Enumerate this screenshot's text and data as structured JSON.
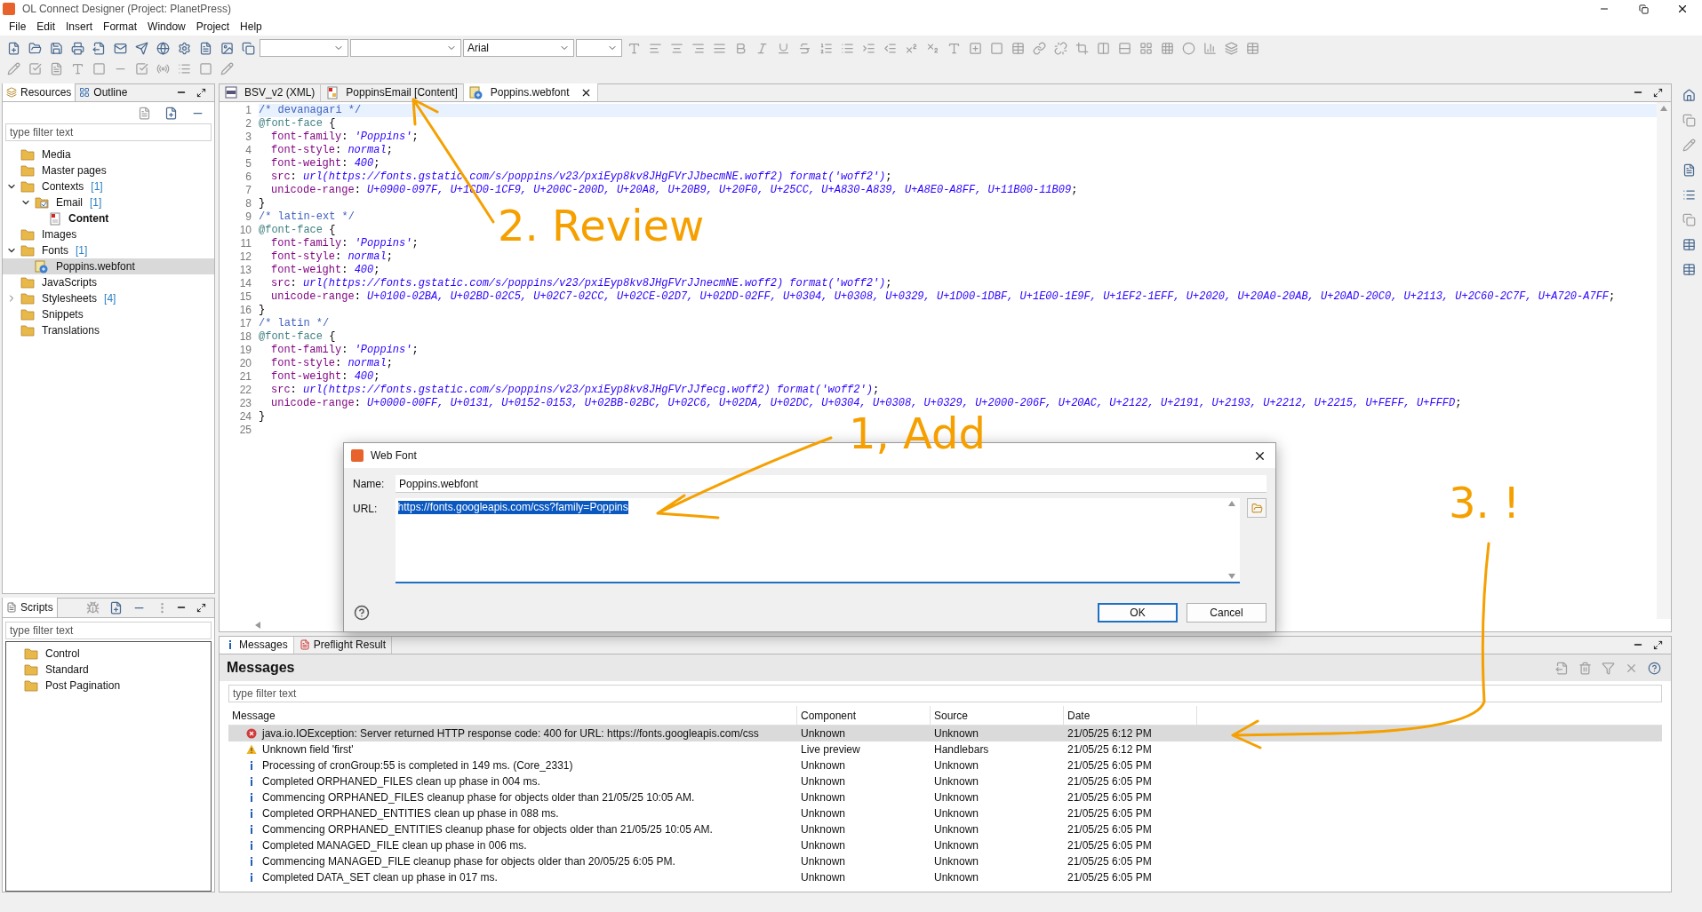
{
  "window": {
    "title": "OL Connect Designer (Project: PlanetPress)"
  },
  "menu": [
    "File",
    "Edit",
    "Insert",
    "Format",
    "Window",
    "Project",
    "Help"
  ],
  "toolbar": {
    "font_combo": "Arial"
  },
  "resources_panel": {
    "tabs": [
      {
        "label": "Resources",
        "selected": true
      },
      {
        "label": "Outline",
        "selected": false
      }
    ],
    "filter": {
      "placeholder": "type filter text"
    },
    "tree": [
      {
        "label": "Media",
        "kind": "folder",
        "selected": false,
        "active": false
      },
      {
        "label": "Master pages",
        "kind": "folder",
        "selected": false,
        "active": false
      },
      {
        "label": "Contexts",
        "count": "[1]",
        "kind": "folder",
        "expanded": true,
        "selected": false,
        "active": false,
        "children": [
          {
            "label": "Email",
            "count": "[1]",
            "kind": "context",
            "expanded": true,
            "selected": false,
            "active": false,
            "children": [
              {
                "label": "Content",
                "kind": "section",
                "selected": false,
                "active": true
              }
            ]
          }
        ]
      },
      {
        "label": "Images",
        "kind": "folder",
        "selected": false,
        "active": false
      },
      {
        "label": "Fonts",
        "count": "[1]",
        "kind": "folder",
        "expanded": true,
        "selected": false,
        "active": false,
        "children": [
          {
            "label": "Poppins.webfont",
            "kind": "webfont",
            "selected": true,
            "active": false
          }
        ]
      },
      {
        "label": "JavaScripts",
        "kind": "folder",
        "selected": false,
        "active": false
      },
      {
        "label": "Stylesheets",
        "count": "[4]",
        "kind": "folder",
        "expanded": false,
        "selected": false,
        "active": false
      },
      {
        "label": "Snippets",
        "kind": "folder",
        "selected": false,
        "active": false
      },
      {
        "label": "Translations",
        "kind": "folder",
        "selected": false,
        "active": false
      }
    ]
  },
  "scripts_panel": {
    "tab": "Scripts",
    "filter": {
      "placeholder": "type filter text"
    },
    "tree": [
      {
        "label": "Control",
        "kind": "folder",
        "selected": false,
        "active": false
      },
      {
        "label": "Standard",
        "kind": "folder",
        "selected": false,
        "active": false
      },
      {
        "label": "Post Pagination",
        "kind": "folder",
        "selected": false,
        "active": false
      }
    ]
  },
  "editor": {
    "tabs": [
      {
        "label": "BSV_v2 (XML)",
        "kind": "xml",
        "selected": false
      },
      {
        "label": "PoppinsEmail [Content]",
        "kind": "template",
        "selected": false
      },
      {
        "label": "Poppins.webfont",
        "kind": "webfont",
        "selected": true
      }
    ],
    "lines": [
      {
        "number": "1",
        "current": true,
        "indent": false,
        "tokens": [
          {
            "kind": "comment",
            "text": "/* devanagari */"
          }
        ]
      },
      {
        "number": "2",
        "current": false,
        "indent": false,
        "tokens": [
          {
            "kind": "at_rule",
            "text": "@font-face"
          },
          {
            "kind": "plain",
            "text": " {"
          }
        ]
      },
      {
        "number": "3",
        "current": false,
        "indent": true,
        "tokens": [
          {
            "kind": "property",
            "text": "font-family"
          },
          {
            "kind": "plain",
            "text": ": "
          },
          {
            "kind": "value",
            "text": "'Poppins'"
          },
          {
            "kind": "plain",
            "text": ";"
          }
        ]
      },
      {
        "number": "4",
        "current": false,
        "indent": true,
        "tokens": [
          {
            "kind": "property",
            "text": "font-style"
          },
          {
            "kind": "plain",
            "text": ": "
          },
          {
            "kind": "value",
            "text": "normal"
          },
          {
            "kind": "plain",
            "text": ";"
          }
        ]
      },
      {
        "number": "5",
        "current": false,
        "indent": true,
        "tokens": [
          {
            "kind": "property",
            "text": "font-weight"
          },
          {
            "kind": "plain",
            "text": ": "
          },
          {
            "kind": "value",
            "text": "400"
          },
          {
            "kind": "plain",
            "text": ";"
          }
        ]
      },
      {
        "number": "6",
        "current": false,
        "indent": true,
        "tokens": [
          {
            "kind": "property",
            "text": "src"
          },
          {
            "kind": "plain",
            "text": ": "
          },
          {
            "kind": "value",
            "text": "url(https://fonts.gstatic.com/s/poppins/v23/pxiEyp8kv8JHgFVrJJbecmNE.woff2) format('woff2')"
          },
          {
            "kind": "plain",
            "text": ";"
          }
        ]
      },
      {
        "number": "7",
        "current": false,
        "indent": true,
        "tokens": [
          {
            "kind": "property",
            "text": "unicode-range"
          },
          {
            "kind": "plain",
            "text": ": "
          },
          {
            "kind": "value",
            "text": "U+0900-097F, U+1CD0-1CF9, U+200C-200D, U+20A8, U+20B9, U+20F0, U+25CC, U+A830-A839, U+A8E0-A8FF, U+11B00-11B09"
          },
          {
            "kind": "plain",
            "text": ";"
          }
        ]
      },
      {
        "number": "8",
        "current": false,
        "indent": false,
        "tokens": [
          {
            "kind": "plain",
            "text": "}"
          }
        ]
      },
      {
        "number": "9",
        "current": false,
        "indent": false,
        "tokens": [
          {
            "kind": "comment",
            "text": "/* latin-ext */"
          }
        ]
      },
      {
        "number": "10",
        "current": false,
        "indent": false,
        "tokens": [
          {
            "kind": "at_rule",
            "text": "@font-face"
          },
          {
            "kind": "plain",
            "text": " {"
          }
        ]
      },
      {
        "number": "11",
        "current": false,
        "indent": true,
        "tokens": [
          {
            "kind": "property",
            "text": "font-family"
          },
          {
            "kind": "plain",
            "text": ": "
          },
          {
            "kind": "value",
            "text": "'Poppins'"
          },
          {
            "kind": "plain",
            "text": ";"
          }
        ]
      },
      {
        "number": "12",
        "current": false,
        "indent": true,
        "tokens": [
          {
            "kind": "property",
            "text": "font-style"
          },
          {
            "kind": "plain",
            "text": ": "
          },
          {
            "kind": "value",
            "text": "normal"
          },
          {
            "kind": "plain",
            "text": ";"
          }
        ]
      },
      {
        "number": "13",
        "current": false,
        "indent": true,
        "tokens": [
          {
            "kind": "property",
            "text": "font-weight"
          },
          {
            "kind": "plain",
            "text": ": "
          },
          {
            "kind": "value",
            "text": "400"
          },
          {
            "kind": "plain",
            "text": ";"
          }
        ]
      },
      {
        "number": "14",
        "current": false,
        "indent": true,
        "tokens": [
          {
            "kind": "property",
            "text": "src"
          },
          {
            "kind": "plain",
            "text": ": "
          },
          {
            "kind": "value",
            "text": "url(https://fonts.gstatic.com/s/poppins/v23/pxiEyp8kv8JHgFVrJJnecmNE.woff2) format('woff2')"
          },
          {
            "kind": "plain",
            "text": ";"
          }
        ]
      },
      {
        "number": "15",
        "current": false,
        "indent": true,
        "tokens": [
          {
            "kind": "property",
            "text": "unicode-range"
          },
          {
            "kind": "plain",
            "text": ": "
          },
          {
            "kind": "value",
            "text": "U+0100-02BA, U+02BD-02C5, U+02C7-02CC, U+02CE-02D7, U+02DD-02FF, U+0304, U+0308, U+0329, U+1D00-1DBF, U+1E00-1E9F, U+1EF2-1EFF, U+2020, U+20A0-20AB, U+20AD-20C0, U+2113, U+2C60-2C7F, U+A720-A7FF"
          },
          {
            "kind": "plain",
            "text": ";"
          }
        ]
      },
      {
        "number": "16",
        "current": false,
        "indent": false,
        "tokens": [
          {
            "kind": "plain",
            "text": "}"
          }
        ]
      },
      {
        "number": "17",
        "current": false,
        "indent": false,
        "tokens": [
          {
            "kind": "comment",
            "text": "/* latin */"
          }
        ]
      },
      {
        "number": "18",
        "current": false,
        "indent": false,
        "tokens": [
          {
            "kind": "at_rule",
            "text": "@font-face"
          },
          {
            "kind": "plain",
            "text": " {"
          }
        ]
      },
      {
        "number": "19",
        "current": false,
        "indent": true,
        "tokens": [
          {
            "kind": "property",
            "text": "font-family"
          },
          {
            "kind": "plain",
            "text": ": "
          },
          {
            "kind": "value",
            "text": "'Poppins'"
          },
          {
            "kind": "plain",
            "text": ";"
          }
        ]
      },
      {
        "number": "20",
        "current": false,
        "indent": true,
        "tokens": [
          {
            "kind": "property",
            "text": "font-style"
          },
          {
            "kind": "plain",
            "text": ": "
          },
          {
            "kind": "value",
            "text": "normal"
          },
          {
            "kind": "plain",
            "text": ";"
          }
        ]
      },
      {
        "number": "21",
        "current": false,
        "indent": true,
        "tokens": [
          {
            "kind": "property",
            "text": "font-weight"
          },
          {
            "kind": "plain",
            "text": ": "
          },
          {
            "kind": "value",
            "text": "400"
          },
          {
            "kind": "plain",
            "text": ";"
          }
        ]
      },
      {
        "number": "22",
        "current": false,
        "indent": true,
        "tokens": [
          {
            "kind": "property",
            "text": "src"
          },
          {
            "kind": "plain",
            "text": ": "
          },
          {
            "kind": "value",
            "text": "url(https://fonts.gstatic.com/s/poppins/v23/pxiEyp8kv8JHgFVrJJfecg.woff2) format('woff2')"
          },
          {
            "kind": "plain",
            "text": ";"
          }
        ]
      },
      {
        "number": "23",
        "current": false,
        "indent": true,
        "tokens": [
          {
            "kind": "property",
            "text": "unicode-range"
          },
          {
            "kind": "plain",
            "text": ": "
          },
          {
            "kind": "value",
            "text": "U+0000-00FF, U+0131, U+0152-0153, U+02BB-02BC, U+02C6, U+02DA, U+02DC, U+0304, U+0308, U+0329, U+2000-206F, U+20AC, U+2122, U+2191, U+2193, U+2212, U+2215, U+FEFF, U+FFFD"
          },
          {
            "kind": "plain",
            "text": ";"
          }
        ]
      },
      {
        "number": "24",
        "current": false,
        "indent": false,
        "tokens": [
          {
            "kind": "plain",
            "text": "}"
          }
        ]
      },
      {
        "number": "25",
        "current": false
      }
    ]
  },
  "dialog": {
    "title": "Web Font",
    "name_label": "Name:",
    "name_value": "Poppins.webfont",
    "url_label": "URL:",
    "url_value": "https://fonts.googleapis.com/css?family=Poppins",
    "url_selected": true,
    "buttons": [
      {
        "label": "OK",
        "default": true
      },
      {
        "label": "Cancel",
        "default": false
      }
    ]
  },
  "messages_panel": {
    "tabs": [
      {
        "label": "Messages",
        "selected": true
      },
      {
        "label": "Preflight Result",
        "selected": false
      }
    ],
    "heading": "Messages",
    "filter": {
      "placeholder": "type filter text"
    },
    "columns": [
      "Message",
      "Component",
      "Source",
      "Date"
    ],
    "rows": [
      {
        "kind": "error",
        "message": "java.io.IOException: Server returned HTTP response code: 400 for URL: https://fonts.googleapis.com/css",
        "component": "Unknown",
        "source": "Unknown",
        "date": "21/05/25 6:12 PM",
        "selected": true
      },
      {
        "kind": "warning",
        "message": "Unknown field 'first'",
        "component": "Live preview",
        "source": "Handlebars",
        "date": "21/05/25 6:12 PM",
        "selected": false
      },
      {
        "kind": "info",
        "message": "Processing of cronGroup:55 is completed in 149 ms. (Core_2331)",
        "component": "Unknown",
        "source": "Unknown",
        "date": "21/05/25 6:05 PM",
        "selected": false
      },
      {
        "kind": "info",
        "message": "Completed ORPHANED_FILES clean up phase in 004 ms.",
        "component": "Unknown",
        "source": "Unknown",
        "date": "21/05/25 6:05 PM",
        "selected": false
      },
      {
        "kind": "info",
        "message": "Commencing ORPHANED_FILES cleanup phase for objects older than 21/05/25 10:05 AM.",
        "component": "Unknown",
        "source": "Unknown",
        "date": "21/05/25 6:05 PM",
        "selected": false
      },
      {
        "kind": "info",
        "message": "Completed ORPHANED_ENTITIES clean up phase in 088 ms.",
        "component": "Unknown",
        "source": "Unknown",
        "date": "21/05/25 6:05 PM",
        "selected": false
      },
      {
        "kind": "info",
        "message": "Commencing ORPHANED_ENTITIES cleanup phase for objects older than 21/05/25 10:05 AM.",
        "component": "Unknown",
        "source": "Unknown",
        "date": "21/05/25 6:05 PM",
        "selected": false
      },
      {
        "kind": "info",
        "message": "Completed MANAGED_FILE clean up phase in 006 ms.",
        "component": "Unknown",
        "source": "Unknown",
        "date": "21/05/25 6:05 PM",
        "selected": false
      },
      {
        "kind": "info",
        "message": "Commencing MANAGED_FILE cleanup phase for objects older than 20/05/25 6:05 PM.",
        "component": "Unknown",
        "source": "Unknown",
        "date": "21/05/25 6:05 PM",
        "selected": false
      },
      {
        "kind": "info",
        "message": "Completed DATA_SET clean up phase in 017 ms.",
        "component": "Unknown",
        "source": "Unknown",
        "date": "21/05/25 6:05 PM",
        "selected": false
      }
    ]
  },
  "annotations": [
    {
      "text": "2. Review"
    },
    {
      "text": "1, Add"
    },
    {
      "text": "3. !"
    }
  ]
}
